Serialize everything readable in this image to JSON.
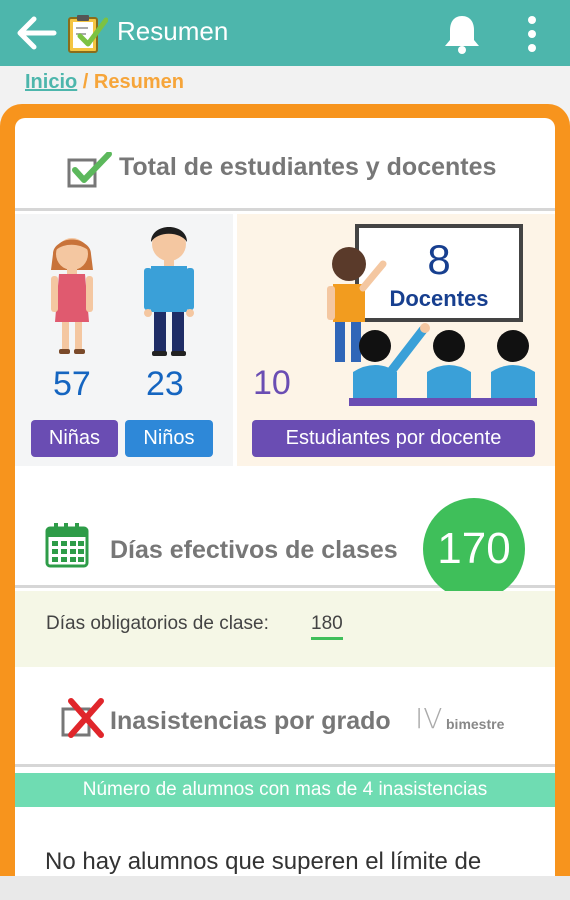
{
  "appbar": {
    "title": "Resumen",
    "icons": [
      "back-arrow-icon",
      "clipboard-check-icon",
      "bell-icon",
      "more-vert-icon"
    ],
    "color": "#4db6ac"
  },
  "breadcrumb": {
    "home": "Inicio",
    "separator": "/",
    "current": "Resumen"
  },
  "students_section": {
    "title": "Total de estudiantes y docentes",
    "girls_count": "57",
    "girls_label": "Niñas",
    "boys_count": "23",
    "boys_label": "Niños",
    "teachers_count": "8",
    "teachers_label": "Docentes",
    "ratio_value": "10",
    "ratio_label": "Estudiantes por docente"
  },
  "days_section": {
    "title": "Días efectivos de clases",
    "effective_days": "170",
    "mandatory_label": "Días obligatorios de clase:",
    "mandatory_value": "180"
  },
  "absences_section": {
    "title": "Inasistencias por grado",
    "period": "IV",
    "period_label": "bimestre",
    "banner": "Número de alumnos con mas de 4 inasistencias",
    "message": "No hay alumnos que superen el límite de"
  },
  "colors": {
    "accent_orange": "#f7941d",
    "green": "#3fbf5a",
    "purple": "#6a4db3",
    "blue": "#2e88d8",
    "mint": "#6fdcb2"
  }
}
